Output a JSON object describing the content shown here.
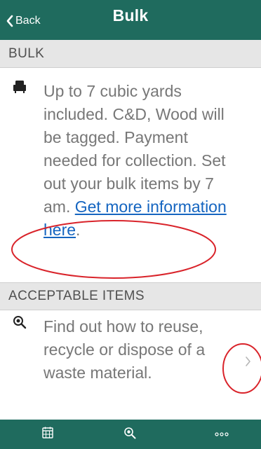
{
  "navbar": {
    "back_label": "Back",
    "title": "Bulk"
  },
  "bulk_section": {
    "header": "BULK",
    "icon": "armchair-icon",
    "text": "Up to 7 cubic yards included. C&D, Wood will be tagged. Payment needed for collection. Set out your bulk items by 7 am. ",
    "link_text": "Get more information here",
    "after_link": "."
  },
  "acceptable_section": {
    "header": "ACCEPTABLE ITEMS",
    "icon": "recycle-search-icon",
    "text": "Find out how to reuse, recycle or dispose of a waste material."
  },
  "tabbar": {
    "tabs": [
      {
        "icon": "calendar-icon"
      },
      {
        "icon": "recycle-search-icon"
      },
      {
        "icon": "more-icon"
      }
    ]
  },
  "colors": {
    "brand": "#1f6b5e",
    "section_bg": "#e6e6e6",
    "body_text": "#777777",
    "link": "#1565c0",
    "annotation": "#d9232a"
  }
}
